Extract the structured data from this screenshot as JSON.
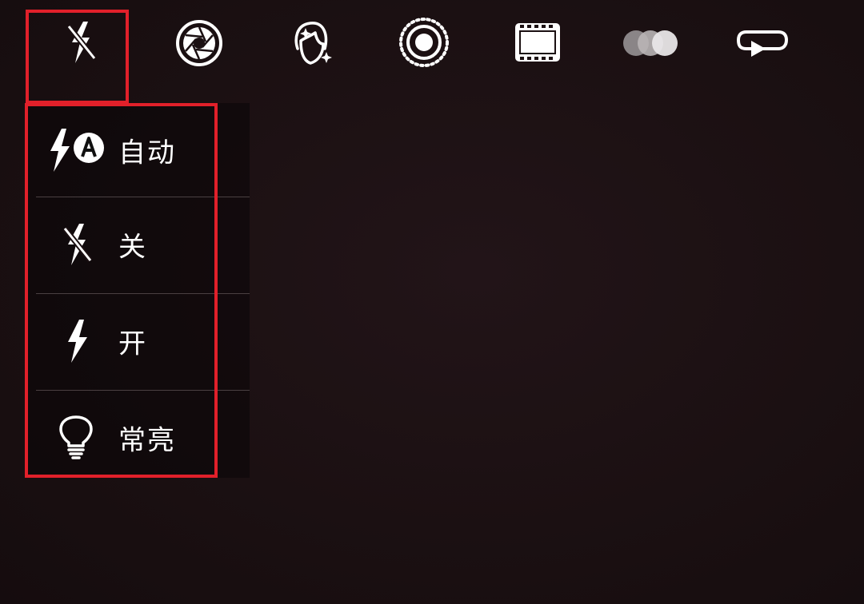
{
  "toolbar": {
    "icons": [
      {
        "name": "flash-off-icon"
      },
      {
        "name": "aperture-icon"
      },
      {
        "name": "beauty-face-icon"
      },
      {
        "name": "live-photo-icon"
      },
      {
        "name": "film-frame-icon"
      },
      {
        "name": "filter-circles-icon"
      },
      {
        "name": "loop-arrow-icon"
      }
    ]
  },
  "flash_menu": {
    "items": [
      {
        "label": "自动",
        "icon": "flash-auto-icon"
      },
      {
        "label": "关",
        "icon": "flash-off-icon"
      },
      {
        "label": "开",
        "icon": "flash-on-icon"
      },
      {
        "label": "常亮",
        "icon": "torch-bulb-icon"
      }
    ],
    "selected": "关"
  },
  "colors": {
    "background": "#1b1012",
    "highlight": "#e1202a",
    "foreground": "#ffffff"
  }
}
